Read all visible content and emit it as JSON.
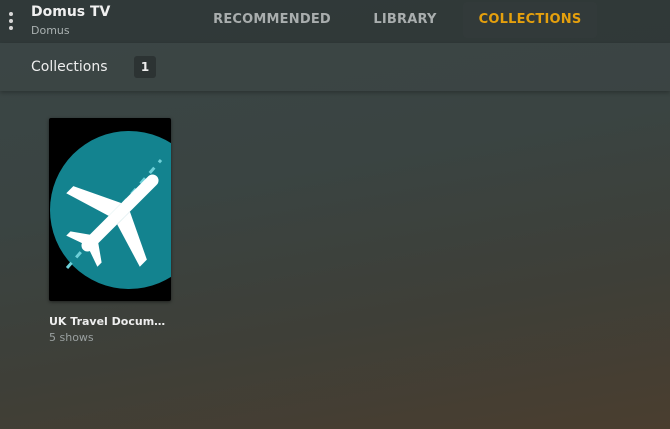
{
  "header": {
    "server_name": "Domus TV",
    "server_subtitle": "Domus"
  },
  "tabs": [
    {
      "label": "RECOMMENDED",
      "active": false
    },
    {
      "label": "LIBRARY",
      "active": false
    },
    {
      "label": "COLLECTIONS",
      "active": true
    }
  ],
  "subheader": {
    "title": "Collections",
    "count": "1"
  },
  "collections": [
    {
      "title": "UK Travel Docume...",
      "subtitle": "5 shows",
      "icon": "airplane-icon"
    }
  ],
  "colors": {
    "accent": "#e5a00d",
    "poster_circle": "#13838f",
    "poster_bg": "#000000"
  }
}
